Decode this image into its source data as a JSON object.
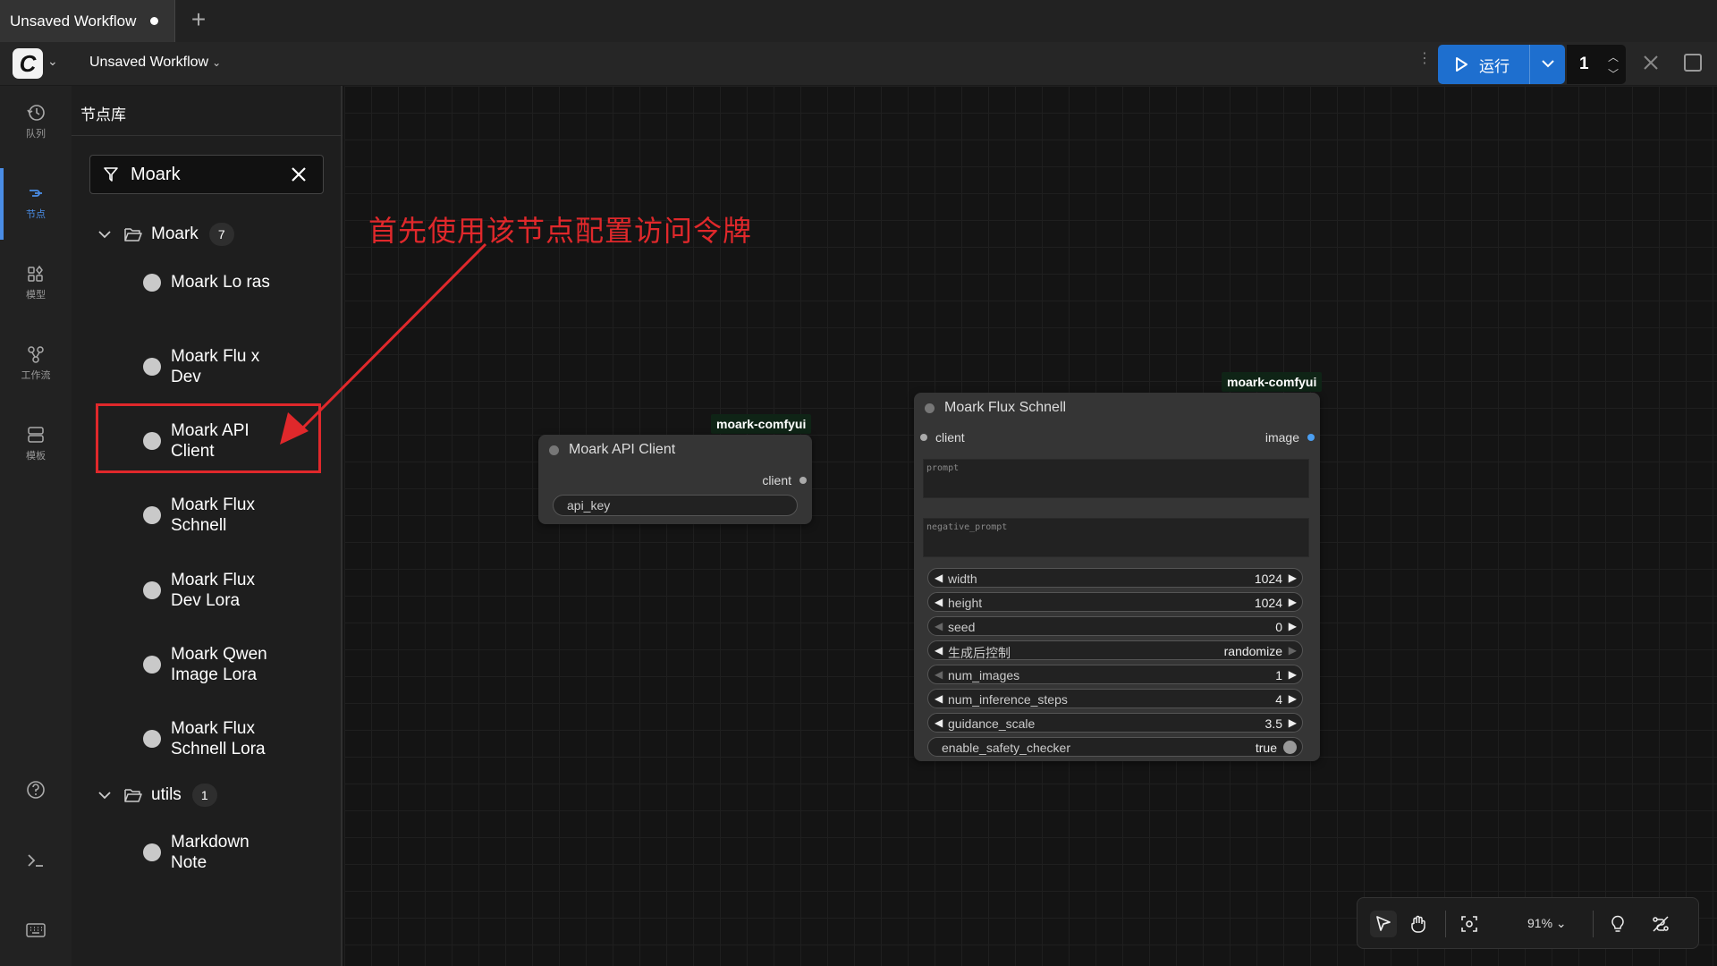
{
  "tab": {
    "title": "Unsaved Workflow"
  },
  "topbar": {
    "workflow_title": "Unsaved Workflow",
    "run_label": "运行",
    "batch_count": "1"
  },
  "rail": {
    "items": [
      {
        "label": "队列",
        "icon": "history-icon"
      },
      {
        "label": "节点",
        "icon": "node-library-icon"
      },
      {
        "label": "模型",
        "icon": "model-library-icon"
      },
      {
        "label": "工作流",
        "icon": "workflow-icon"
      },
      {
        "label": "模板",
        "icon": "templates-icon"
      }
    ]
  },
  "panel": {
    "title": "节点库",
    "search_value": "Moark",
    "folders": [
      {
        "name": "Moark",
        "count": "7",
        "items": [
          "Moark Lo ras",
          "Moark Flu x Dev",
          "Moark API Client",
          "Moark Flux Schnell",
          "Moark Flux Dev Lora",
          "Moark Qwen Image Lora",
          "Moark Flux Schnell Lora"
        ]
      },
      {
        "name": "utils",
        "count": "1",
        "items": [
          "Markdown Note"
        ]
      }
    ]
  },
  "annotation": "首先使用该节点配置访问令牌",
  "nodes": {
    "api_client": {
      "badge": "moark-comfyui",
      "title": "Moark API Client",
      "output": "client",
      "field": "api_key"
    },
    "flux_schnell": {
      "badge": "moark-comfyui",
      "title": "Moark Flux Schnell",
      "input": "client",
      "output": "image",
      "prompt_placeholder": "prompt",
      "negative_placeholder": "negative_prompt",
      "widgets": [
        {
          "name": "width",
          "value": "1024"
        },
        {
          "name": "height",
          "value": "1024"
        },
        {
          "name": "seed",
          "value": "0"
        },
        {
          "name": "生成后控制",
          "value": "randomize"
        },
        {
          "name": "num_images",
          "value": "1"
        },
        {
          "name": "num_inference_steps",
          "value": "4"
        },
        {
          "name": "guidance_scale",
          "value": "3.5"
        },
        {
          "name": "enable_safety_checker",
          "value": "true"
        }
      ]
    }
  },
  "toolbar": {
    "zoom": "91%"
  },
  "colors": {
    "accent": "#1e6fcf",
    "annotation": "#e0282b",
    "badge_bg": "#0f2416"
  }
}
